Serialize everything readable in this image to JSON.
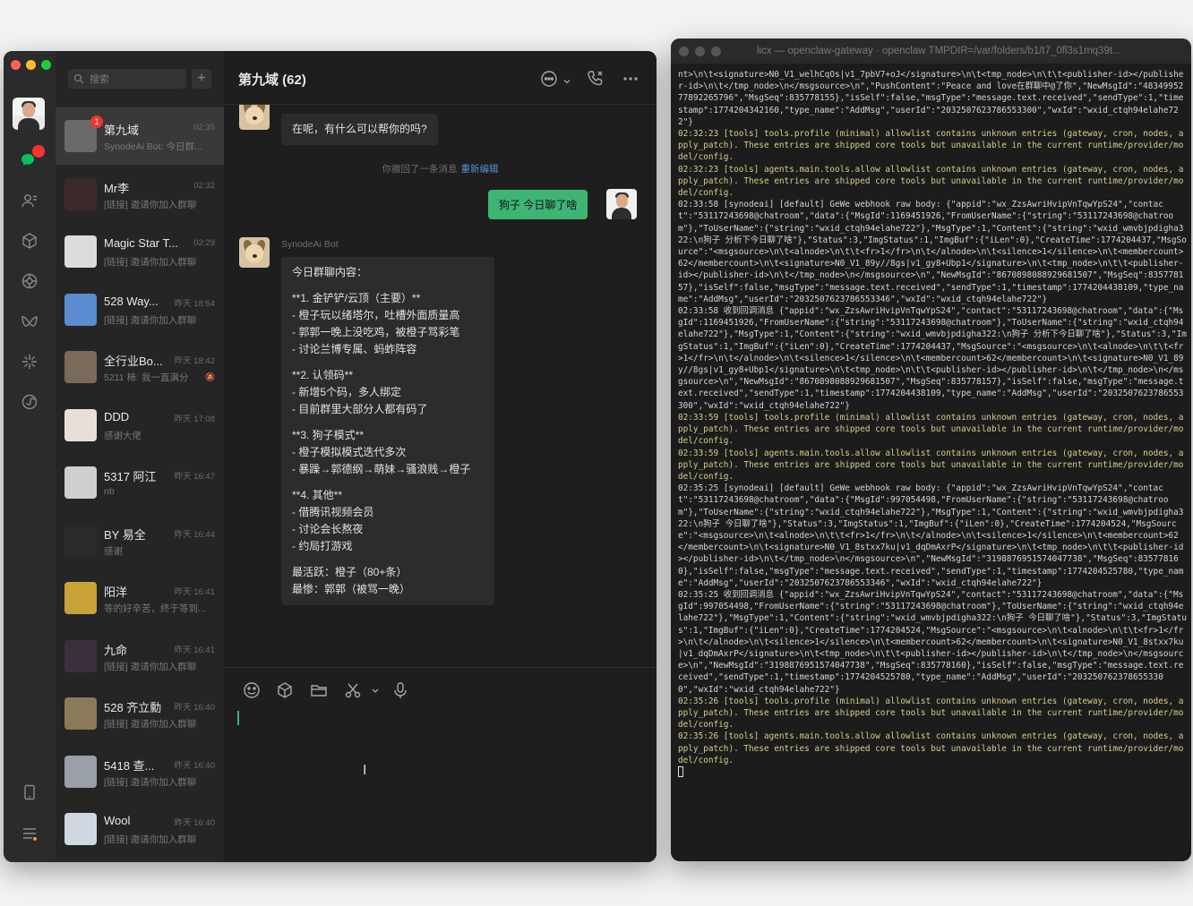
{
  "wechat": {
    "search_placeholder": "搜索",
    "plus": "+",
    "conversation_title": "第九域 (62)",
    "chats": [
      {
        "name": "第九域",
        "time": "02:35",
        "preview": "SynodeAi Bot: 今日群...",
        "badge": "1",
        "avatar_color": "#6a6a6a"
      },
      {
        "name": "Mr李",
        "time": "02:32",
        "preview": "[链接] 邀请你加入群聊",
        "avatar_color": "#3c2a2a"
      },
      {
        "name": "Magic Star T...",
        "time": "02:29",
        "preview": "[链接] 邀请你加入群聊",
        "avatar_color": "#dcdcdc"
      },
      {
        "name": "528 Way...",
        "time": "昨天 18:54",
        "preview": "[链接] 邀请你加入群聊",
        "avatar_color": "#5a8ccf"
      },
      {
        "name": "全行业Bo...",
        "time": "昨天 18:42",
        "preview": "5211 柿: 我一直满分",
        "avatar_color": "#7a6a5a",
        "muted": true
      },
      {
        "name": "DDD",
        "time": "昨天 17:08",
        "preview": "感谢大佬",
        "avatar_color": "#e8e0d8"
      },
      {
        "name": "5317 阿江",
        "time": "昨天 16:47",
        "preview": "nb",
        "avatar_color": "#cfcfcf"
      },
      {
        "name": "BY 易全",
        "time": "昨天 16:44",
        "preview": "感谢",
        "avatar_color": "#2a2a2a"
      },
      {
        "name": "阳洋",
        "time": "昨天 16:41",
        "preview": "等的好辛苦，终于等到...",
        "avatar_color": "#c9a23a"
      },
      {
        "name": "九命",
        "time": "昨天 16:41",
        "preview": "[链接] 邀请你加入群聊",
        "avatar_color": "#3a2f3a"
      },
      {
        "name": "528 齐立勳",
        "time": "昨天 16:40",
        "preview": "[链接] 邀请你加入群聊",
        "avatar_color": "#8a7a5a"
      },
      {
        "name": "5418 查...",
        "time": "昨天 16:40",
        "preview": "[链接] 邀请你加入群聊",
        "avatar_color": "#9aa0a8"
      },
      {
        "name": "Wool",
        "time": "昨天 16:40",
        "preview": "[链接] 邀请你加入群聊",
        "avatar_color": "#cfd8e0"
      }
    ],
    "messages": {
      "bot_name": "SynodeAi Bot",
      "first_bubble": "在呢，有什么可以帮你的吗?",
      "system_text": "你撤回了一条消息",
      "system_link": "重新编辑",
      "my_message": "狗子 今日聊了啥",
      "summary_lines": [
        "今日群聊内容：",
        "",
        "**1. 金铲铲/云顶（主要）**",
        "- 橙子玩以绪塔尔，吐槽外面质量高",
        "- 郭郭一晚上没吃鸡，被橙子骂彩笔",
        "- 讨论兰博专属、蚂蚱阵容",
        "",
        "**2. 认领码**",
        "- 新增5个码，多人绑定",
        "- 目前群里大部分人都有码了",
        "",
        "**3. 狗子模式**",
        "- 橙子模拟模式迭代多次",
        "- 暴躁→郭德纲→萌妹→骚浪贱→橙子",
        "",
        "**4. 其他**",
        "- 借腾讯视频会员",
        "- 讨论会长熬夜",
        "- 约局打游戏",
        "",
        "最活跃：橙子（80+条）",
        "最惨：郭郭（被骂一晚）"
      ]
    }
  },
  "terminal": {
    "title": "licx — openclaw-gateway · openclaw TMPDIR=/var/folders/b1/t7_0fl3s1mq39t...",
    "lines": [
      {
        "t": "nt>\\n\\t<signature>N0_V1_welhCqOs|v1_7pbV7+oJ</signature>\\n\\t<tmp_node>\\n\\t\\t<publisher-id></publisher-id>\\n\\t</tmp_node>\\n</msgsource>\\n\",\"PushContent\":\"Peace and love在群聊中@了你\",\"NewMsgId\":\"4834995277892265796\",\"MsgSeq\":835778155},\"isSelf\":false,\"msgType\":\"message.text.received\",\"sendType\":1,\"timestamp\":1774204342160,\"type_name\":\"AddMsg\",\"userId\":\"2032507623786553300\",\"wxId\":\"wxid_ctqh94elahe722\"}",
        "c": "n"
      },
      {
        "t": "02:32:23 [tools] tools.profile (minimal) allowlist contains unknown entries (gateway, cron, nodes, apply_patch). These entries are shipped core tools but unavailable in the current runtime/provider/model/config.",
        "c": "w"
      },
      {
        "t": "02:32:23 [tools] agents.main.tools.allow allowlist contains unknown entries (gateway, cron, nodes, apply_patch). These entries are shipped core tools but unavailable in the current runtime/provider/model/config.",
        "c": "w"
      },
      {
        "t": "02:33:58 [synodeai] [default] GeWe webhook raw body: {\"appid\":\"wx_ZzsAwriHvipVnTqwYpS24\",\"contact\":\"53117243698@chatroom\",\"data\":{\"MsgId\":1169451926,\"FromUserName\":{\"string\":\"53117243698@chatroom\"},\"ToUserName\":{\"string\":\"wxid_ctqh94elahe722\"},\"MsgType\":1,\"Content\":{\"string\":\"wxid_wmvbjpdigha322:\\n狗子 分析下今日聊了啥\"},\"Status\":3,\"ImgStatus\":1,\"ImgBuf\":{\"iLen\":0},\"CreateTime\":1774204437,\"MsgSource\":\"<msgsource>\\n\\t<alnode>\\n\\t\\t<fr>1</fr>\\n\\t</alnode>\\n\\t<silence>1</silence>\\n\\t<membercount>62</membercount>\\n\\t<signature>N0_V1_89y//8gs|v1_gy8+Ubp1</signature>\\n\\t<tmp_node>\\n\\t\\t<publisher-id></publisher-id>\\n\\t</tmp_node>\\n</msgsource>\\n\",\"NewMsgId\":\"8670898088929681507\",\"MsgSeq\":835778157},\"isSelf\":false,\"msgType\":\"message.text.received\",\"sendType\":1,\"timestamp\":1774204438109,\"type_name\":\"AddMsg\",\"userId\":\"2032507623786553346\",\"wxId\":\"wxid_ctqh94elahe722\"}",
        "c": "n"
      },
      {
        "t": "02:33:58 收到回调消息 {\"appid\":\"wx_ZzsAwriHvipVnTqwYpS24\",\"contact\":\"53117243698@chatroom\",\"data\":{\"MsgId\":1169451926,\"FromUserName\":{\"string\":\"53117243698@chatroom\"},\"ToUserName\":{\"string\":\"wxid_ctqh94elahe722\"},\"MsgType\":1,\"Content\":{\"string\":\"wxid_wmvbjpdigha322:\\n狗子 分析下今日聊了啥\"},\"Status\":3,\"ImgStatus\":1,\"ImgBuf\":{\"iLen\":0},\"CreateTime\":1774204437,\"MsgSource\":\"<msgsource>\\n\\t<alnode>\\n\\t\\t<fr>1</fr>\\n\\t</alnode>\\n\\t<silence>1</silence>\\n\\t<membercount>62</membercount>\\n\\t<signature>N0_V1_89y//8gs|v1_gy8+Ubp1</signature>\\n\\t<tmp_node>\\n\\t\\t<publisher-id></publisher-id>\\n\\t</tmp_node>\\n</msgsource>\\n\",\"NewMsgId\":\"8670898088929681507\",\"MsgSeq\":835778157},\"isSelf\":false,\"msgType\":\"message.text.received\",\"sendType\":1,\"timestamp\":1774204438109,\"type_name\":\"AddMsg\",\"userId\":\"2032507623786553300\",\"wxId\":\"wxid_ctqh94elahe722\"}",
        "c": "n"
      },
      {
        "t": "02:33:59 [tools] tools.profile (minimal) allowlist contains unknown entries (gateway, cron, nodes, apply_patch). These entries are shipped core tools but unavailable in the current runtime/provider/model/config.",
        "c": "w"
      },
      {
        "t": "02:33:59 [tools] agents.main.tools.allow allowlist contains unknown entries (gateway, cron, nodes, apply_patch). These entries are shipped core tools but unavailable in the current runtime/provider/model/config.",
        "c": "w"
      },
      {
        "t": "02:35:25 [synodeai] [default] GeWe webhook raw body: {\"appid\":\"wx_ZzsAwriHvipVnTqwYpS24\",\"contact\":\"53117243698@chatroom\",\"data\":{\"MsgId\":997054498,\"FromUserName\":{\"string\":\"53117243698@chatroom\"},\"ToUserName\":{\"string\":\"wxid_ctqh94elahe722\"},\"MsgType\":1,\"Content\":{\"string\":\"wxid_wmvbjpdigha322:\\n狗子 今日聊了啥\"},\"Status\":3,\"ImgStatus\":1,\"ImgBuf\":{\"iLen\":0},\"CreateTime\":1774204524,\"MsgSource\":\"<msgsource>\\n\\t<alnode>\\n\\t\\t<fr>1</fr>\\n\\t</alnode>\\n\\t<silence>1</silence>\\n\\t<membercount>62</membercount>\\n\\t<signature>N0_V1_8stxx7ku|v1_dqDmAxrP</signature>\\n\\t<tmp_node>\\n\\t\\t<publisher-id></publisher-id>\\n\\t</tmp_node>\\n</msgsource>\\n\",\"NewMsgId\":\"3198876951574047738\",\"MsgSeq\":835778160},\"isSelf\":false,\"msgType\":\"message.text.received\",\"sendType\":1,\"timestamp\":1774204525780,\"type_name\":\"AddMsg\",\"userId\":\"2032507623786553346\",\"wxId\":\"wxid_ctqh94elahe722\"}",
        "c": "n"
      },
      {
        "t": "02:35:25 收到回调消息 {\"appid\":\"wx_ZzsAwriHvipVnTqwYpS24\",\"contact\":\"53117243698@chatroom\",\"data\":{\"MsgId\":997054498,\"FromUserName\":{\"string\":\"53117243698@chatroom\"},\"ToUserName\":{\"string\":\"wxid_ctqh94elahe722\"},\"MsgType\":1,\"Content\":{\"string\":\"wxid_wmvbjpdigha322:\\n狗子 今日聊了啥\"},\"Status\":3,\"ImgStatus\":1,\"ImgBuf\":{\"iLen\":0},\"CreateTime\":1774204524,\"MsgSource\":\"<msgsource>\\n\\t<alnode>\\n\\t\\t<fr>1</fr>\\n\\t</alnode>\\n\\t<silence>1</silence>\\n\\t<membercount>62</membercount>\\n\\t<signature>N0_V1_8stxx7ku|v1_dqDmAxrP</signature>\\n\\t<tmp_node>\\n\\t\\t<publisher-id></publisher-id>\\n\\t</tmp_node>\\n</msgsource>\\n\",\"NewMsgId\":\"3198876951574047738\",\"MsgSeq\":835778160},\"isSelf\":false,\"msgType\":\"message.text.received\",\"sendType\":1,\"timestamp\":1774204525780,\"type_name\":\"AddMsg\",\"userId\":\"2032507623786553300\",\"wxId\":\"wxid_ctqh94elahe722\"}",
        "c": "n"
      },
      {
        "t": "02:35:26 [tools] tools.profile (minimal) allowlist contains unknown entries (gateway, cron, nodes, apply_patch). These entries are shipped core tools but unavailable in the current runtime/provider/model/config.",
        "c": "w"
      },
      {
        "t": "02:35:26 [tools] agents.main.tools.allow allowlist contains unknown entries (gateway, cron, nodes, apply_patch). These entries are shipped core tools but unavailable in the current runtime/provider/model/config.",
        "c": "w"
      }
    ]
  },
  "colors": {
    "accent_green": "#3eb575",
    "badge_red": "#f43530",
    "terminal_warn": "#d6cd8b",
    "terminal_tag": "#3a7bd5"
  }
}
